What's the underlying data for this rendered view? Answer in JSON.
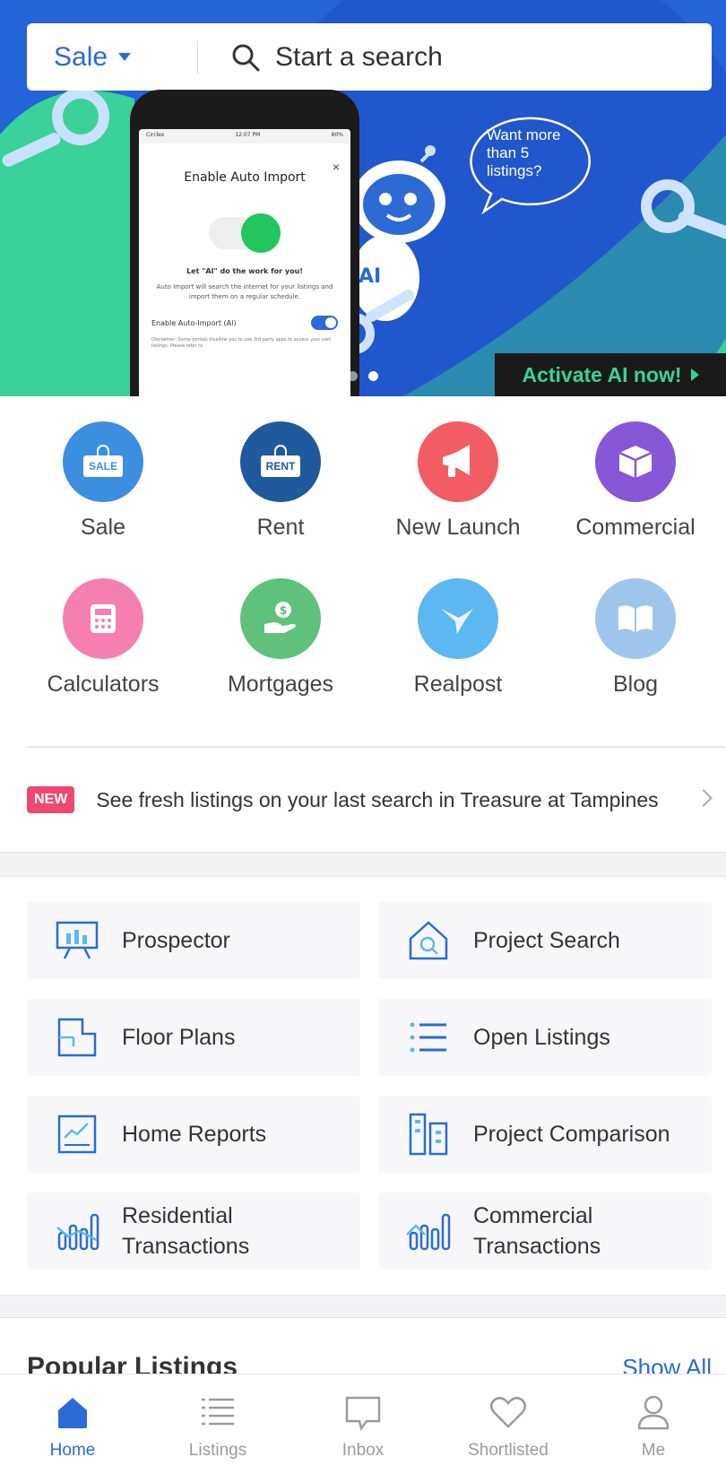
{
  "search": {
    "mode": "Sale",
    "placeholder": "Start a search"
  },
  "banner": {
    "phone": {
      "status_left": "Circles",
      "status_time": "12:07 PM",
      "status_right": "80%",
      "title": "Enable Auto Import",
      "close": "×",
      "headline": "Let \"AI\" do the work for you!",
      "body": "Auto Import will search the internet for your listings and import them on a regular schedule.",
      "toggle_label": "Enable Auto-Import (AI)",
      "disclaimer": "Disclaimer: Some portals disallow you to use 3rd party apps to access your own listings. Please refer to"
    },
    "bubble_text": "Want more than 5 listings?",
    "cta": "Activate AI now!",
    "slides": 2,
    "active_slide": 2
  },
  "categories": [
    {
      "label": "Sale",
      "icon": "sale-sign-icon",
      "color": "#3b8ee0",
      "sign": "SALE"
    },
    {
      "label": "Rent",
      "icon": "rent-sign-icon",
      "color": "#1e5a9c",
      "sign": "RENT"
    },
    {
      "label": "New Launch",
      "icon": "megaphone-icon",
      "color": "#f25c62"
    },
    {
      "label": "Commercial",
      "icon": "box-icon",
      "color": "#8657d6"
    },
    {
      "label": "Calculators",
      "icon": "calculator-icon",
      "color": "#f47fb0"
    },
    {
      "label": "Mortgages",
      "icon": "money-hand-icon",
      "color": "#5fc17a"
    },
    {
      "label": "Realpost",
      "icon": "bird-icon",
      "color": "#5db7f0"
    },
    {
      "label": "Blog",
      "icon": "book-icon",
      "color": "#9ec6ec"
    }
  ],
  "notice": {
    "badge": "NEW",
    "text": "See fresh listings on your last search in Treasure at Tampines"
  },
  "tools": [
    {
      "label": "Prospector",
      "icon": "presentation-chart-icon"
    },
    {
      "label": "Project Search",
      "icon": "house-search-icon"
    },
    {
      "label": "Floor Plans",
      "icon": "floor-plan-icon"
    },
    {
      "label": "Open Listings",
      "icon": "list-icon"
    },
    {
      "label": "Home Reports",
      "icon": "report-chart-icon"
    },
    {
      "label": "Project Comparison",
      "icon": "buildings-compare-icon"
    },
    {
      "label": "Residential\nTransactions",
      "label_line1": "Residential",
      "label_line2": "Transactions",
      "icon": "bar-trend-icon"
    },
    {
      "label": "Commercial\nTransactions",
      "label_line1": "Commercial",
      "label_line2": "Transactions",
      "icon": "bar-trend-house-icon"
    }
  ],
  "popular": {
    "title": "Popular Listings",
    "show_all": "Show All"
  },
  "bottom_nav": [
    {
      "label": "Home",
      "icon": "home-icon",
      "active": true
    },
    {
      "label": "Listings",
      "icon": "listings-icon",
      "active": false
    },
    {
      "label": "Inbox",
      "icon": "inbox-icon",
      "active": false
    },
    {
      "label": "Shortlisted",
      "icon": "heart-icon",
      "active": false
    },
    {
      "label": "Me",
      "icon": "user-icon",
      "active": false
    }
  ],
  "colors": {
    "brand_blue": "#2c6ad6",
    "banner_blue": "#2563d8",
    "banner_green": "#3ad29a",
    "badge_pink": "#f0476f"
  }
}
